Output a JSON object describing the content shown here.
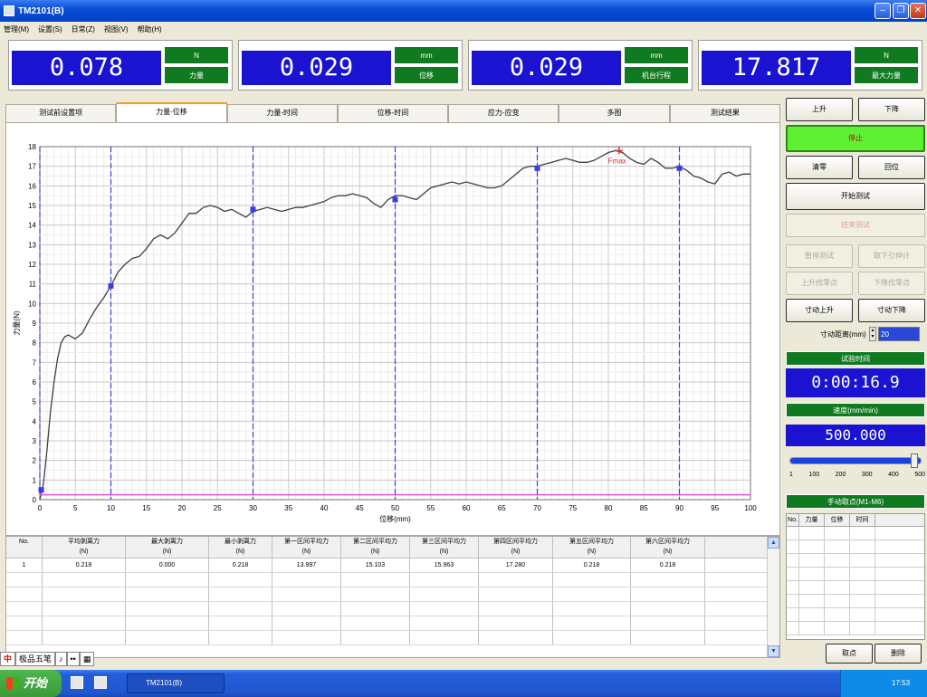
{
  "window": {
    "title": "TM2101(B)"
  },
  "menu": [
    "管理(M)",
    "设置(S)",
    "日常(Z)",
    "视图(V)",
    "帮助(H)"
  ],
  "readouts": [
    {
      "value": "0.078",
      "unit": "N",
      "name": "力量"
    },
    {
      "value": "0.029",
      "unit": "mm",
      "name": "位移"
    },
    {
      "value": "0.029",
      "unit": "mm",
      "name": "机台行程"
    },
    {
      "value": "17.817",
      "unit": "N",
      "name": "最大力量"
    }
  ],
  "tabs": [
    "测试前设置项",
    "力量-位移",
    "力量-时间",
    "位移-时间",
    "应力-应变",
    "多图",
    "测试结果"
  ],
  "active_tab": 1,
  "chart_data": {
    "type": "line",
    "xlabel": "位移(mm)",
    "ylabel": "力量(N)",
    "xlim": [
      0,
      100
    ],
    "ylim": [
      0,
      18
    ],
    "xticks": [
      "0",
      "5",
      "10",
      "15",
      "20",
      "25",
      "30",
      "35",
      "40",
      "45",
      "50",
      "55",
      "60",
      "65",
      "70",
      "75",
      "80",
      "85",
      "90",
      "95",
      "100"
    ],
    "yticks": [
      "0",
      "1",
      "2",
      "3",
      "4",
      "5",
      "6",
      "7",
      "8",
      "9",
      "10",
      "11",
      "12",
      "13",
      "14",
      "15",
      "16",
      "17",
      "18"
    ],
    "grid": true,
    "series": [
      {
        "color": "#404040",
        "x": [
          0,
          0.5,
          1,
          1.5,
          2,
          2.5,
          3,
          3.5,
          4,
          5,
          6,
          7,
          8,
          9,
          10,
          11,
          12,
          13,
          14,
          15,
          16,
          17,
          18,
          19,
          20,
          21,
          22,
          23,
          24,
          25,
          26,
          27,
          28,
          29,
          30,
          31,
          32,
          33,
          34,
          35,
          36,
          37,
          38,
          39,
          40,
          41,
          42,
          43,
          44,
          45,
          46,
          47,
          48,
          49,
          50,
          51,
          52,
          53,
          54,
          55,
          56,
          57,
          58,
          59,
          60,
          61,
          62,
          63,
          64,
          65,
          66,
          67,
          68,
          69,
          70,
          71,
          72,
          73,
          74,
          75,
          76,
          77,
          78,
          79,
          80,
          81,
          82,
          83,
          84,
          85,
          86,
          87,
          88,
          89,
          90,
          91,
          92,
          93,
          94,
          95,
          96,
          97,
          98,
          99,
          100
        ],
        "y": [
          0,
          0.8,
          2.5,
          4.5,
          6,
          7.2,
          8,
          8.3,
          8.4,
          8.2,
          8.5,
          9.2,
          9.8,
          10.3,
          10.9,
          11.6,
          12,
          12.3,
          12.4,
          12.8,
          13.3,
          13.5,
          13.3,
          13.6,
          14.1,
          14.6,
          14.6,
          14.9,
          15,
          14.9,
          14.7,
          14.8,
          14.6,
          14.4,
          14.7,
          14.8,
          14.9,
          14.8,
          14.7,
          14.8,
          14.9,
          14.9,
          15,
          15.1,
          15.2,
          15.4,
          15.5,
          15.5,
          15.6,
          15.5,
          15.4,
          15.1,
          14.9,
          15.3,
          15.5,
          15.5,
          15.4,
          15.3,
          15.6,
          15.9,
          16,
          16.1,
          16.2,
          16.1,
          16.2,
          16.1,
          16,
          15.9,
          15.9,
          16,
          16.3,
          16.6,
          16.9,
          17,
          17,
          17.1,
          17.2,
          17.3,
          17.4,
          17.3,
          17.2,
          17.2,
          17.3,
          17.5,
          17.7,
          17.8,
          17.7,
          17.4,
          17.2,
          17.1,
          17.4,
          17.2,
          16.9,
          16.9,
          17,
          16.8,
          16.5,
          16.4,
          16.2,
          16.1,
          16.6,
          16.7,
          16.5,
          16.6,
          16.6
        ]
      },
      {
        "color": "#e050e0",
        "x": [
          0,
          100
        ],
        "y": [
          0.25,
          0.25
        ]
      }
    ],
    "interval_lines_x": [
      0,
      10,
      30,
      50,
      70,
      90
    ],
    "markers": [
      {
        "x": 0.2,
        "y": 0.5
      },
      {
        "x": 10,
        "y": 10.9
      },
      {
        "x": 30,
        "y": 14.8
      },
      {
        "x": 50,
        "y": 15.3
      },
      {
        "x": 70,
        "y": 16.9
      },
      {
        "x": 90,
        "y": 16.9
      }
    ],
    "peak_label": {
      "text": "Fmax",
      "x": 81.5,
      "y": 17.8
    }
  },
  "table": {
    "headers": [
      [
        "No.",
        ""
      ],
      [
        "平均剥离力",
        "(N)"
      ],
      [
        "最大剥离力",
        "(N)"
      ],
      [
        "最小剥离力",
        "(N)"
      ],
      [
        "第一区间平均力",
        "(N)"
      ],
      [
        "第二区间平均力",
        "(N)"
      ],
      [
        "第三区间平均力",
        "(N)"
      ],
      [
        "第四区间平均力",
        "(N)"
      ],
      [
        "第五区间平均力",
        "(N)"
      ],
      [
        "第六区间平均力",
        "(N)"
      ]
    ],
    "rows": [
      [
        "1",
        "0.218",
        "0.000",
        "0.218",
        "13.997",
        "15.103",
        "15.963",
        "17.280",
        "0.218",
        "0.218"
      ]
    ]
  },
  "ime": [
    "中",
    "极品五笔",
    "♪",
    "••",
    "▦"
  ],
  "controls": {
    "up": "上升",
    "down": "下降",
    "stop": "停止",
    "clear": "清零",
    "return": "回位",
    "start_test": "开始测试",
    "end_test": "结束测试",
    "pause_test": "暂停测试",
    "remove_gauge": "取下引伸计",
    "up_zero": "上升找零点",
    "down_zero": "下降找零点",
    "jog_up": "寸动上升",
    "jog_down": "寸动下降",
    "jog_distance_label": "寸动距离(mm)",
    "jog_distance_value": "20",
    "test_time_label": "试验时间",
    "test_time_value": "0:00:16.9",
    "speed_label": "速度(mm/min)",
    "speed_value": "500.000",
    "speed_ticks": [
      "1",
      "100",
      "200",
      "300",
      "400",
      "500"
    ],
    "speed_fraction": 1.0,
    "manual_points_label": "手动取点(M1-M6)",
    "manual_headers": [
      "No.",
      "力量",
      "位移",
      "时间"
    ],
    "btn_points": "取点",
    "btn_delete": "删除"
  },
  "taskbar": {
    "start": "开始",
    "task": "TM2101(B)",
    "clock": "17:53"
  }
}
